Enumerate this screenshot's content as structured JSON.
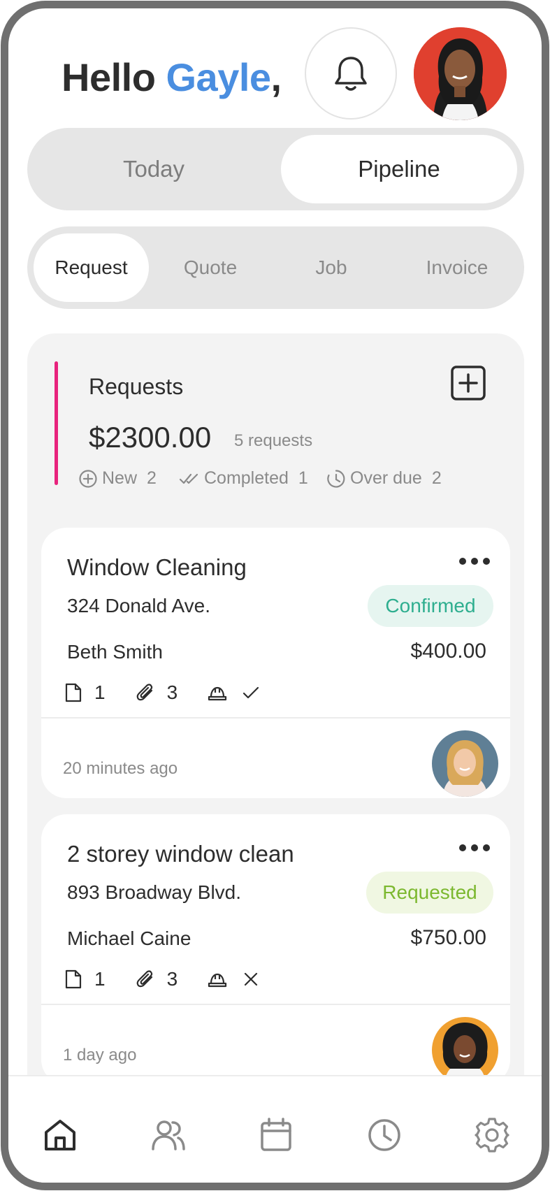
{
  "header": {
    "greeting": "Hello",
    "name": "Gayle",
    "comma": ","
  },
  "view_toggle": {
    "options": [
      "Today",
      "Pipeline"
    ],
    "selected": "Pipeline"
  },
  "stage_tabs": {
    "items": [
      "Request",
      "Quote",
      "Job",
      "Invoice"
    ],
    "selected": "Request"
  },
  "summary": {
    "title": "Requests",
    "amount": "$2300.00",
    "count": "5 requests",
    "stats": [
      {
        "label": "New",
        "value": "2",
        "icon": "plus-circle-icon"
      },
      {
        "label": "Completed",
        "value": "1",
        "icon": "double-check-icon"
      },
      {
        "label": "Over due",
        "value": "2",
        "icon": "clock-icon"
      }
    ]
  },
  "requests": [
    {
      "title": "Window Cleaning",
      "address": "324 Donald Ave.",
      "status": "Confirmed",
      "status_color": "#2eae8f",
      "status_bg": "#e6f5f0",
      "client": "Beth Smith",
      "price": "$400.00",
      "notes": "1",
      "attachments": "3",
      "time": "20 minutes ago"
    },
    {
      "title": "2 storey window clean",
      "address": "893 Broadway Blvd.",
      "status": "Requested",
      "status_color": "#7cb82f",
      "status_bg": "#f0f7e2",
      "client": "Michael Caine",
      "price": "$750.00",
      "notes": "1",
      "attachments": "3",
      "time": "1 day ago"
    }
  ],
  "bottom_nav": [
    "home-icon",
    "users-icon",
    "calendar-icon",
    "clock-icon",
    "settings-icon"
  ],
  "colors": {
    "accent_name": "#4a8ee0",
    "accent_bar": "#e8237d"
  }
}
